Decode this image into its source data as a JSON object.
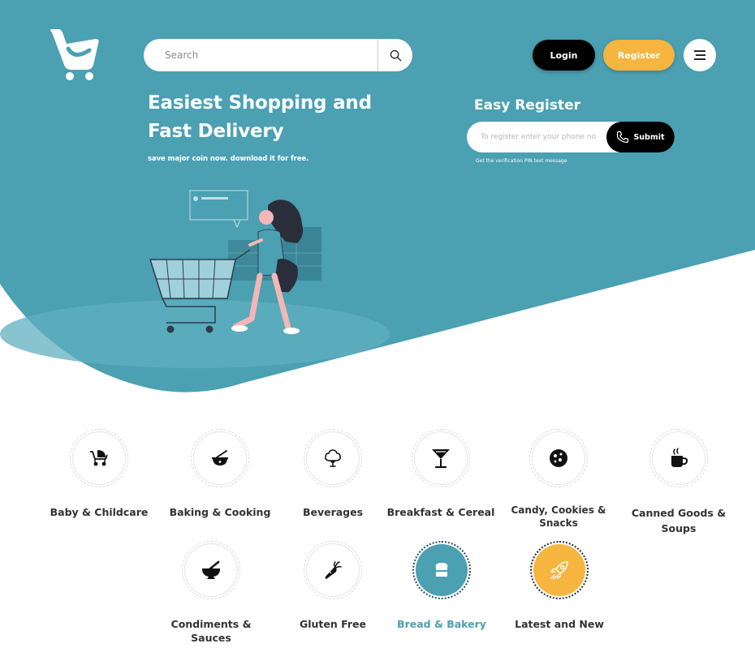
{
  "header": {
    "search": {
      "placeholder": "Search"
    },
    "login_label": "Login",
    "register_label": "Register"
  },
  "hero": {
    "title_line1": "Easiest Shopping and",
    "title_line2": "Fast Delivery",
    "subtitle": "save major coin now. download it for free."
  },
  "register": {
    "title": "Easy Register",
    "phone_placeholder": "To register enter your phone no",
    "submit_label": "Submit",
    "hint": "Get the verification PIN text message"
  },
  "categories": [
    {
      "label": "Baby & Childcare",
      "icon": "stroller-icon"
    },
    {
      "label": "Baking & Cooking",
      "icon": "mixing-bowl-icon"
    },
    {
      "label": "Beverages",
      "icon": "tree-icon"
    },
    {
      "label": "Breakfast & Cereal",
      "icon": "cocktail-glass-icon"
    },
    {
      "label": "Candy, Cookies & Snacks",
      "icon": "cookie-icon"
    },
    {
      "label": "Canned Goods & Soups",
      "icon": "hot-cup-icon"
    },
    {
      "label": "Condiments & Sauces",
      "icon": "mortar-pestle-icon"
    },
    {
      "label": "Gluten Free",
      "icon": "carrot-icon"
    },
    {
      "label": "Bread & Bakery",
      "icon": "bread-icon",
      "active": true
    },
    {
      "label": "Latest and New",
      "icon": "rocket-icon"
    }
  ],
  "colors": {
    "primary": "#4ba0b2",
    "accent": "#f5b53f",
    "dark": "#000000"
  }
}
